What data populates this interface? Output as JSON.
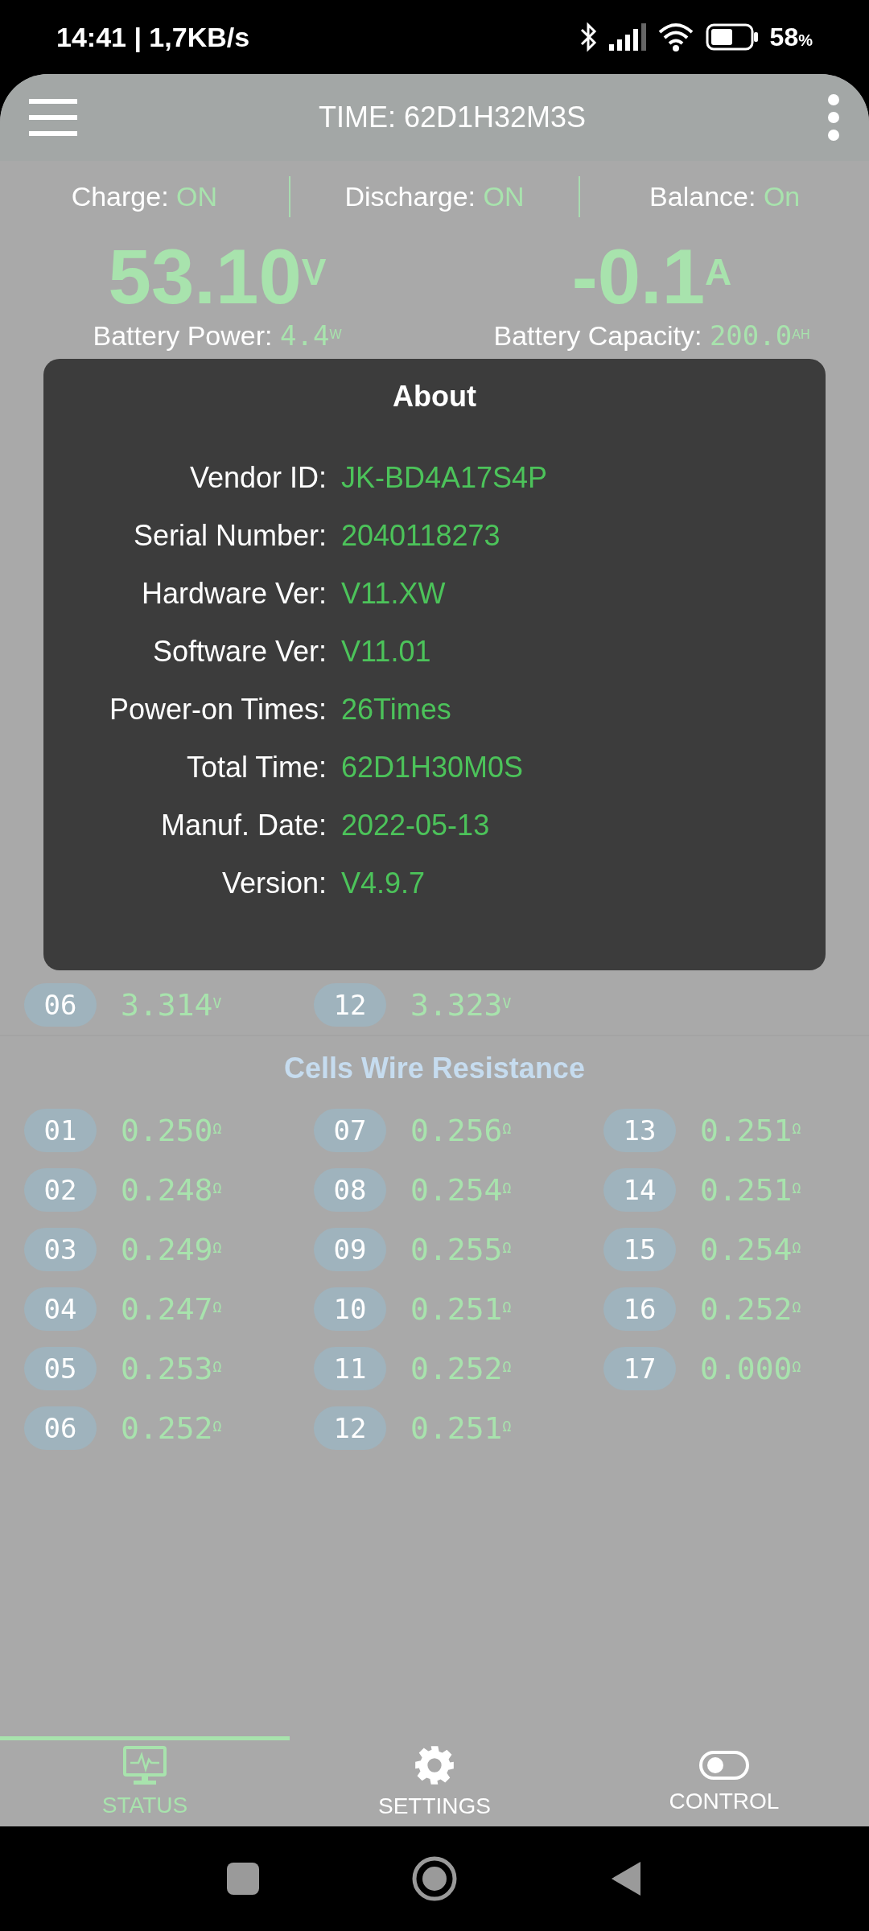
{
  "status_bar": {
    "time": "14:41 | 1,7KB/s",
    "battery": "58",
    "battery_unit": "%"
  },
  "header": {
    "title": "TIME: 62D1H32M3S"
  },
  "switches": [
    {
      "label": "Charge:",
      "value": "ON"
    },
    {
      "label": "Discharge:",
      "value": "ON"
    },
    {
      "label": "Balance:",
      "value": "On"
    }
  ],
  "readings": [
    {
      "value": "53.10",
      "unit": "V"
    },
    {
      "value": "-0.1",
      "unit": "A"
    }
  ],
  "stats": [
    {
      "label": "Battery Power:",
      "value": "4.4",
      "unit": "W"
    },
    {
      "label": "Battery Capacity:",
      "value": "200.0",
      "unit": "AH"
    }
  ],
  "about_dialog": {
    "title": "About",
    "rows": [
      {
        "label": "Vendor ID:",
        "value": "JK-BD4A17S4P"
      },
      {
        "label": "Serial Number:",
        "value": "2040118273"
      },
      {
        "label": "Hardware Ver:",
        "value": "V11.XW"
      },
      {
        "label": "Software Ver:",
        "value": "V11.01"
      },
      {
        "label": "Power-on Times:",
        "value": "26Times"
      },
      {
        "label": "Total Time:",
        "value": "62D1H30M0S"
      },
      {
        "label": "Manuf. Date:",
        "value": "2022-05-13"
      },
      {
        "label": "Version:",
        "value": "V4.9.7"
      }
    ]
  },
  "cell_voltages": [
    {
      "index": "06",
      "value": "3.314",
      "unit": "V"
    },
    {
      "index": "12",
      "value": "3.323",
      "unit": "V"
    }
  ],
  "wire_resistance": {
    "title": "Cells Wire Resistance",
    "cells": [
      {
        "index": "01",
        "value": "0.250",
        "unit": "Ω"
      },
      {
        "index": "02",
        "value": "0.248",
        "unit": "Ω"
      },
      {
        "index": "03",
        "value": "0.249",
        "unit": "Ω"
      },
      {
        "index": "04",
        "value": "0.247",
        "unit": "Ω"
      },
      {
        "index": "05",
        "value": "0.253",
        "unit": "Ω"
      },
      {
        "index": "06",
        "value": "0.252",
        "unit": "Ω"
      },
      {
        "index": "07",
        "value": "0.256",
        "unit": "Ω"
      },
      {
        "index": "08",
        "value": "0.254",
        "unit": "Ω"
      },
      {
        "index": "09",
        "value": "0.255",
        "unit": "Ω"
      },
      {
        "index": "10",
        "value": "0.251",
        "unit": "Ω"
      },
      {
        "index": "11",
        "value": "0.252",
        "unit": "Ω"
      },
      {
        "index": "12",
        "value": "0.251",
        "unit": "Ω"
      },
      {
        "index": "13",
        "value": "0.251",
        "unit": "Ω"
      },
      {
        "index": "14",
        "value": "0.251",
        "unit": "Ω"
      },
      {
        "index": "15",
        "value": "0.254",
        "unit": "Ω"
      },
      {
        "index": "16",
        "value": "0.252",
        "unit": "Ω"
      },
      {
        "index": "17",
        "value": "0.000",
        "unit": "Ω"
      }
    ]
  },
  "tabs": [
    {
      "label": "STATUS",
      "kind": "monitor",
      "selected": true
    },
    {
      "label": "SETTINGS",
      "kind": "gear",
      "selected": false
    },
    {
      "label": "CONTROL",
      "kind": "toggle",
      "selected": false
    }
  ]
}
